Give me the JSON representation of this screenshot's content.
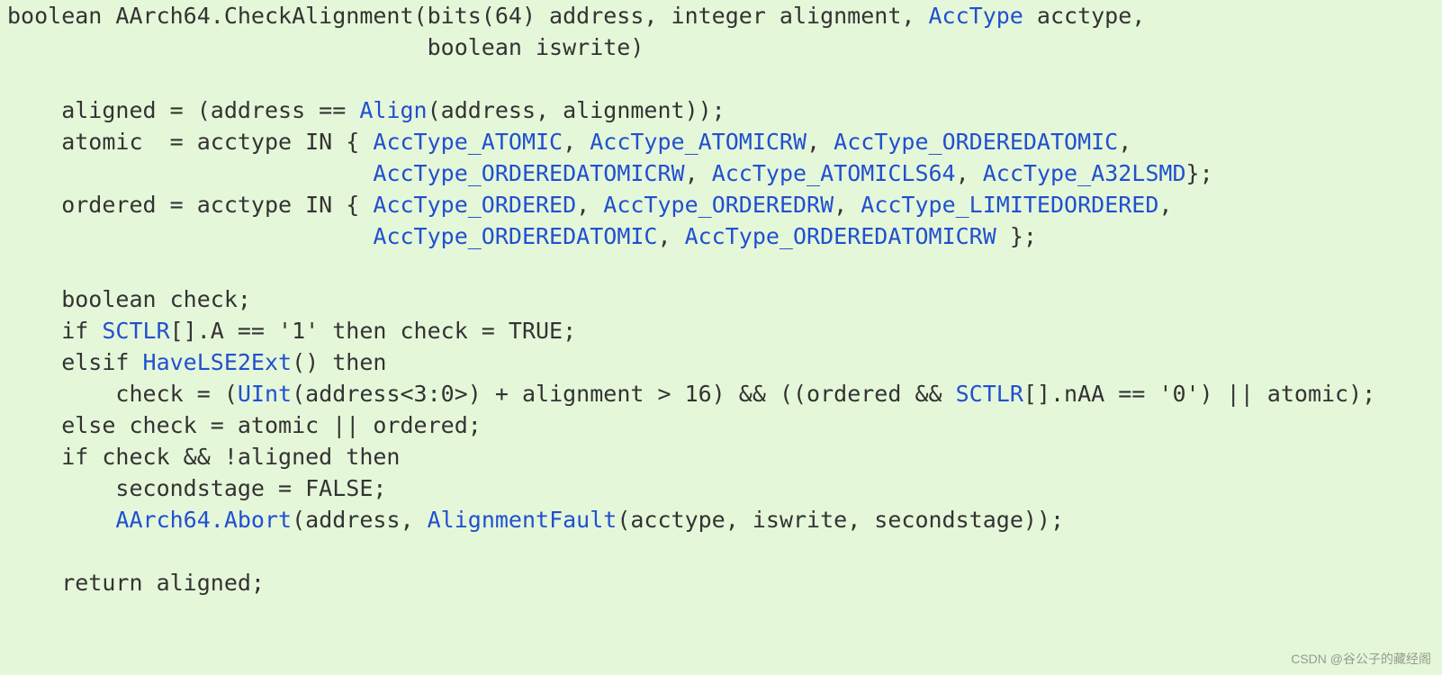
{
  "code": {
    "l1a": "boolean AArch64.CheckAlignment(bits(64) address, integer alignment, ",
    "l1b": "AccType",
    "l1c": " acctype,",
    "l2": "                               boolean iswrite)",
    "l3": "",
    "l4a": "    aligned = (address == ",
    "l4b": "Align",
    "l4c": "(address, alignment));",
    "l5a": "    atomic  = acctype IN { ",
    "l5b": "AccType_ATOMIC",
    "l5c": ", ",
    "l5d": "AccType_ATOMICRW",
    "l5e": ", ",
    "l5f": "AccType_ORDEREDATOMIC",
    "l5g": ",",
    "l6a": "                           ",
    "l6b": "AccType_ORDEREDATOMICRW",
    "l6c": ", ",
    "l6d": "AccType_ATOMICLS64",
    "l6e": ", ",
    "l6f": "AccType_A32LSMD",
    "l6g": "};",
    "l7a": "    ordered = acctype IN { ",
    "l7b": "AccType_ORDERED",
    "l7c": ", ",
    "l7d": "AccType_ORDEREDRW",
    "l7e": ", ",
    "l7f": "AccType_LIMITEDORDERED",
    "l7g": ",",
    "l8a": "                           ",
    "l8b": "AccType_ORDEREDATOMIC",
    "l8c": ", ",
    "l8d": "AccType_ORDEREDATOMICRW",
    "l8e": " };",
    "l9": "",
    "l10": "    boolean check;",
    "l11a": "    if ",
    "l11b": "SCTLR",
    "l11c": "[].A == '1' then check = TRUE;",
    "l12a": "    elsif ",
    "l12b": "HaveLSE2Ext",
    "l12c": "() then",
    "l13a": "        check = (",
    "l13b": "UInt",
    "l13c": "(address<3:0>) + alignment > 16) && ((ordered && ",
    "l13d": "SCTLR",
    "l13e": "[].nAA == '0') || atomic);",
    "l14": "    else check = atomic || ordered;",
    "l15": "    if check && !aligned then",
    "l16": "        secondstage = FALSE;",
    "l17a": "        ",
    "l17b": "AArch64.Abort",
    "l17c": "(address, ",
    "l17d": "AlignmentFault",
    "l17e": "(acctype, iswrite, secondstage));",
    "l18": "",
    "l19": "    return aligned;"
  },
  "watermark": "CSDN @谷公子的藏经阁"
}
